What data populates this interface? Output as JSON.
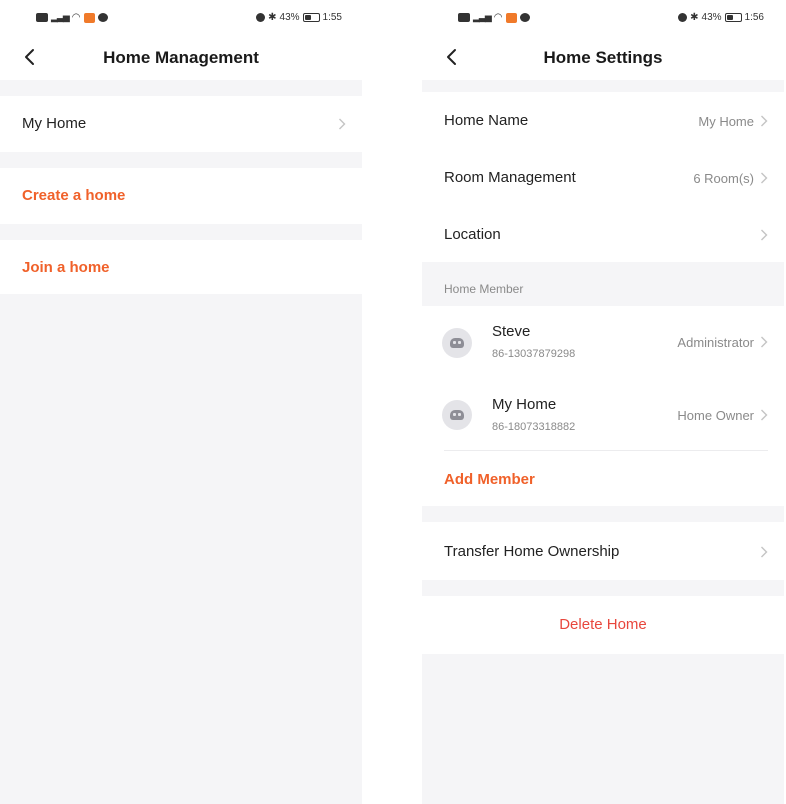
{
  "left_screen": {
    "status_bar": {
      "left_icons": [
        "hd-icon",
        "signal-icon",
        "wifi-icon",
        "app-notification-icon",
        "message-icon"
      ],
      "battery": "43%",
      "time": "1:55"
    },
    "nav": {
      "back_icon": "chevron-left-icon",
      "title": "Home Management"
    },
    "items": [
      {
        "label": "My Home"
      },
      {
        "label": "Create a home"
      },
      {
        "label": "Join a home"
      }
    ]
  },
  "right_screen": {
    "status_bar": {
      "left_icons": [
        "hd-icon",
        "signal-icon",
        "wifi-icon",
        "app-notification-icon",
        "message-icon"
      ],
      "battery": "43%",
      "time": "1:56"
    },
    "nav": {
      "back_icon": "chevron-left-icon",
      "title": "Home Settings"
    },
    "settings": [
      {
        "label": "Home Name",
        "value": "My Home"
      },
      {
        "label": "Room Management",
        "value": "6 Room(s)"
      },
      {
        "label": "Location",
        "value": ""
      }
    ],
    "members_header": "Home Member",
    "members": [
      {
        "name": "Steve",
        "phone": "86-13037879298",
        "role": "Administrator"
      },
      {
        "name": "My Home",
        "phone": "86-18073318882",
        "role": "Home Owner"
      }
    ],
    "add_member": "Add Member",
    "transfer": "Transfer Home Ownership",
    "delete": "Delete Home"
  },
  "colors": {
    "accent": "#f0612a",
    "danger": "#e8473d",
    "background": "#f5f5f7",
    "surface": "#ffffff",
    "secondary_text": "#8a8a8a"
  }
}
